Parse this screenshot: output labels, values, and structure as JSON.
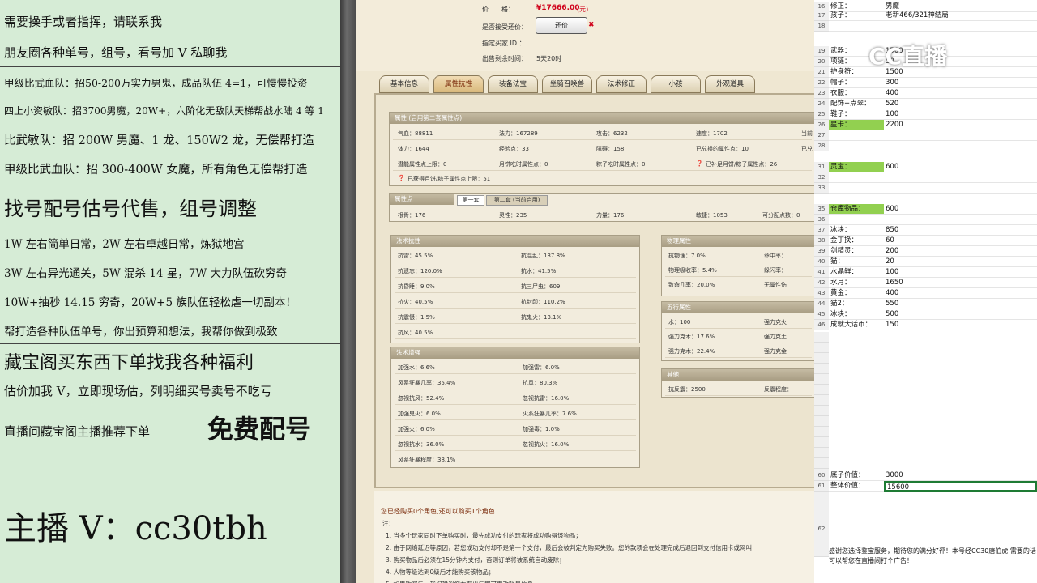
{
  "promo": {
    "lines": [
      "需要操手或者指挥，请联系我",
      "朋友圈各种单号，组号，看号加 V 私聊我",
      "甲级比武血队：招50-200万实力男鬼，成品队伍 4=1，可慢慢投资",
      "四上小资敏队：招3700男魔，20W+，六阶化无敌队天梯帮战水陆 4 等 1",
      "比武敏队：招 200W 男魔、1 龙、150W2 龙，无偿帮打造",
      "甲级比武血队：招 300-400W 女魔，所有角色无偿帮打造",
      "找号配号估号代售，组号调整",
      "1W 左右简单日常，2W 左右卓越日常，炼狱地宫",
      "3W 左右异光通关，5W 混杀 14 星，7W 大力队伍砍穷奇",
      "10W+抽秒 14.15 穷奇，20W+5 族队伍轻松虐一切副本！",
      "帮打造各种队伍单号，你出预算和想法，我帮你做到极致",
      "藏宝阁买东西下单找我各种福利",
      "估价加我 V，立即现场估，列明细买号卖号不吃亏",
      "直播间藏宝阁主播推荐下单",
      "免费配号",
      "主播 V：cc30tbh"
    ]
  },
  "game": {
    "price_label": "价　　格：",
    "price_value": "¥17666.00",
    "price_unit": "(元)",
    "bargain_label": "是否接受还价：",
    "bargain_button": "还价",
    "buyer_label": "指定买家 ID ：",
    "remaining_label": "出售剩余时间：",
    "remaining_value": "5天20时",
    "tabs": [
      "基本信息",
      "属性抗性",
      "装备法宝",
      "坐骑召唤兽",
      "法术修正",
      "小孩",
      "外观道具"
    ],
    "attr_title": "属性 (启用第二套属性点)",
    "attr_rows": [
      [
        "气血：88811",
        "法力：167289",
        "攻击：6232",
        "速度：1702",
        "当前"
      ],
      [
        "体力：1644",
        "经验点：33",
        "障碍：158",
        "已兑换的属性点：10",
        "已兑"
      ],
      [
        "潜能属性点上限：0",
        "月饼吃时属性点：0",
        "粽子吃时属性点：0",
        "已补足月饼/粽子属性点：26",
        ""
      ]
    ],
    "attr_note": "已获得月饼/粽子属性点上限：51",
    "points_title": "属性点",
    "points_tab1": "第一套",
    "points_tab2": "第二套 (当前启用)",
    "points_row": [
      "根骨：176",
      "灵性：235",
      "力量：176",
      "敏捷：1053",
      "可分配点数：0"
    ],
    "resist_title": "法术抗性",
    "resist": [
      [
        "抗雷：45.5%",
        "抗混乱：137.8%"
      ],
      [
        "抗遗忘：120.0%",
        "抗水：41.5%"
      ],
      [
        "抗昏睡：9.0%",
        "抗三尸虫：609"
      ],
      [
        "抗火：40.5%",
        "抗封印：110.2%"
      ],
      [
        "抗震慑：1.5%",
        "抗鬼火：13.1%"
      ],
      [
        "抗风：40.5%",
        ""
      ]
    ],
    "boost_title": "法术增强",
    "boost": [
      [
        "加强水：6.6%",
        "加强雷：6.0%"
      ],
      [
        "风系狂暴几率：35.4%",
        "抗风：80.3%"
      ],
      [
        "忽视抗风：52.4%",
        "忽视抗雷：16.0%"
      ],
      [
        "加强鬼火：6.0%",
        "火系狂暴几率：7.6%"
      ],
      [
        "加强火：6.0%",
        "加强毒：1.0%"
      ],
      [
        "忽视抗水：36.0%",
        "忽视抗火：16.0%"
      ],
      [
        "风系狂暴程度：38.1%",
        ""
      ]
    ],
    "phys_title": "物理属性",
    "phys": [
      [
        "抗物理：7.0%",
        "命中率："
      ],
      [
        "物理吸收率：5.4%",
        "躲闪率："
      ],
      [
        "致命几率：20.0%",
        "无属性伤"
      ]
    ],
    "element_title": "五行属性",
    "element": [
      [
        "水：100",
        "强力克火"
      ],
      [
        "强力克木：17.6%",
        "强力克土"
      ],
      [
        "强力克木：22.4%",
        "强力克金"
      ]
    ],
    "other_title": "其他",
    "other": [
      [
        "抗反震：2500",
        "反震程度："
      ]
    ],
    "notice_head": "您已经购买0个角色,还可以购买1个角色",
    "notice_lines": [
      "注：",
      "1. 当多个玩家同时下单购买时，最先成功支付的玩家将成功购得该物品；",
      "2. 由于网络延迟等原因，若您成功支付却不是第一个支付，最后会被判定为购买失败。您的款项会在处理完成后退回到支付信用卡或网叫",
      "3. 购买物品后必须在15分钟内支付，否则订单将被系统自动废除；",
      "4. 人物等级达到0级后才能购买该物品；",
      "5. 如果购买后，我们建议您在取出后即可更改账号信息。"
    ]
  },
  "sheet": {
    "rows": [
      {
        "n": "16",
        "a": "修正：",
        "b": "男魔"
      },
      {
        "n": "17",
        "a": "孩子：",
        "b": "老新466/321神结局"
      },
      {
        "n": "18",
        "a": "",
        "b": ""
      },
      {
        "n": "19",
        "a": "武器：",
        "b": "1500"
      },
      {
        "n": "20",
        "a": "项链：",
        "b": "50"
      },
      {
        "n": "21",
        "a": "护身符：",
        "b": "1500"
      },
      {
        "n": "22",
        "a": "帽子：",
        "b": "300"
      },
      {
        "n": "23",
        "a": "衣服：",
        "b": "400"
      },
      {
        "n": "24",
        "a": "配饰+点翠：",
        "b": "520"
      },
      {
        "n": "25",
        "a": "鞋子：",
        "b": "100"
      },
      {
        "n": "26",
        "a": "星卡：",
        "b": "2200",
        "g": true
      },
      {
        "n": "27",
        "a": "",
        "b": ""
      },
      {
        "n": "28",
        "a": "",
        "b": ""
      },
      {
        "n": "31",
        "a": "灵宝：",
        "b": "600",
        "g": true
      },
      {
        "n": "32",
        "a": "",
        "b": ""
      },
      {
        "n": "33",
        "a": "",
        "b": ""
      },
      {
        "n": "35",
        "a": "仓库物品：",
        "b": "600",
        "g": true
      },
      {
        "n": "36",
        "a": "",
        "b": ""
      },
      {
        "n": "37",
        "a": "冰块：",
        "b": "850"
      },
      {
        "n": "38",
        "a": "金丁换：",
        "b": "60"
      },
      {
        "n": "39",
        "a": "剑精灵：",
        "b": "200"
      },
      {
        "n": "40",
        "a": "猫：",
        "b": "20"
      },
      {
        "n": "41",
        "a": "水晶鲜：",
        "b": "100"
      },
      {
        "n": "42",
        "a": "水月：",
        "b": "1650"
      },
      {
        "n": "43",
        "a": "黄金：",
        "b": "400"
      },
      {
        "n": "44",
        "a": "猫2：",
        "b": "550"
      },
      {
        "n": "45",
        "a": "冰块：",
        "b": "500"
      },
      {
        "n": "46",
        "a": "成就大话币：",
        "b": "150"
      }
    ],
    "bottom_rows": [
      {
        "n": "60",
        "a": "底子价值：",
        "b": "3000"
      },
      {
        "n": "61",
        "a": "整体价值：",
        "b": "15600"
      }
    ],
    "footer_num": "62",
    "footer_text": "感谢您选择鉴宝服务，期待您的满分好评！本号经CC30唐伯虎 需要的话可以帮您在直播间打个广告！",
    "watermark": "CC直播"
  },
  "colors": {
    "promo_bg": "#d6ecd6",
    "price_red": "#d0021b",
    "sheet_green": "#92d050",
    "tab_active": "#d9b97c"
  }
}
